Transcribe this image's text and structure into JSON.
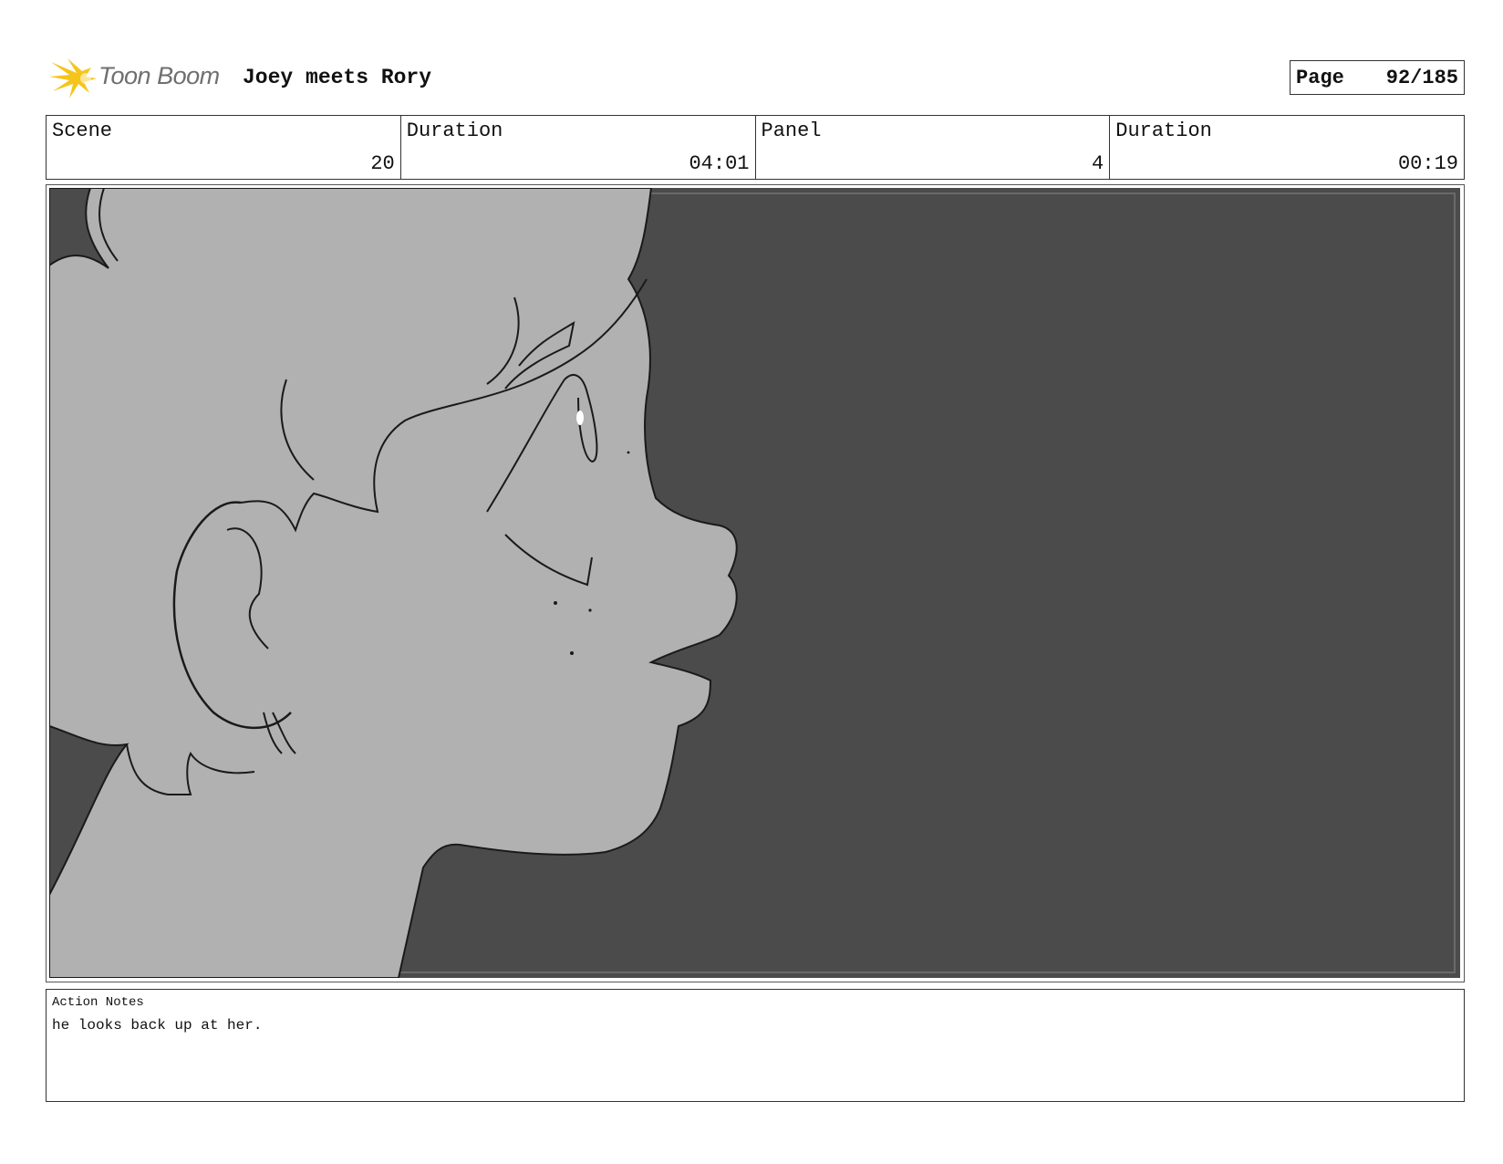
{
  "header": {
    "brand": "Toon Boom",
    "brand_icon": "toon-boom-starburst-icon",
    "project_title": "Joey meets Rory",
    "page_label": "Page",
    "page_number": "92/185"
  },
  "info": {
    "scene_label": "Scene",
    "scene_value": "20",
    "scene_duration_label": "Duration",
    "scene_duration_value": "04:01",
    "panel_label": "Panel",
    "panel_value": "4",
    "panel_duration_label": "Duration",
    "panel_duration_value": "00:19"
  },
  "panel": {
    "background_color": "#4b4b4b",
    "skin_color": "#b1b1b1",
    "line_color": "#1a1a1a"
  },
  "notes": {
    "label": "Action Notes",
    "text": "he looks back up at her."
  }
}
